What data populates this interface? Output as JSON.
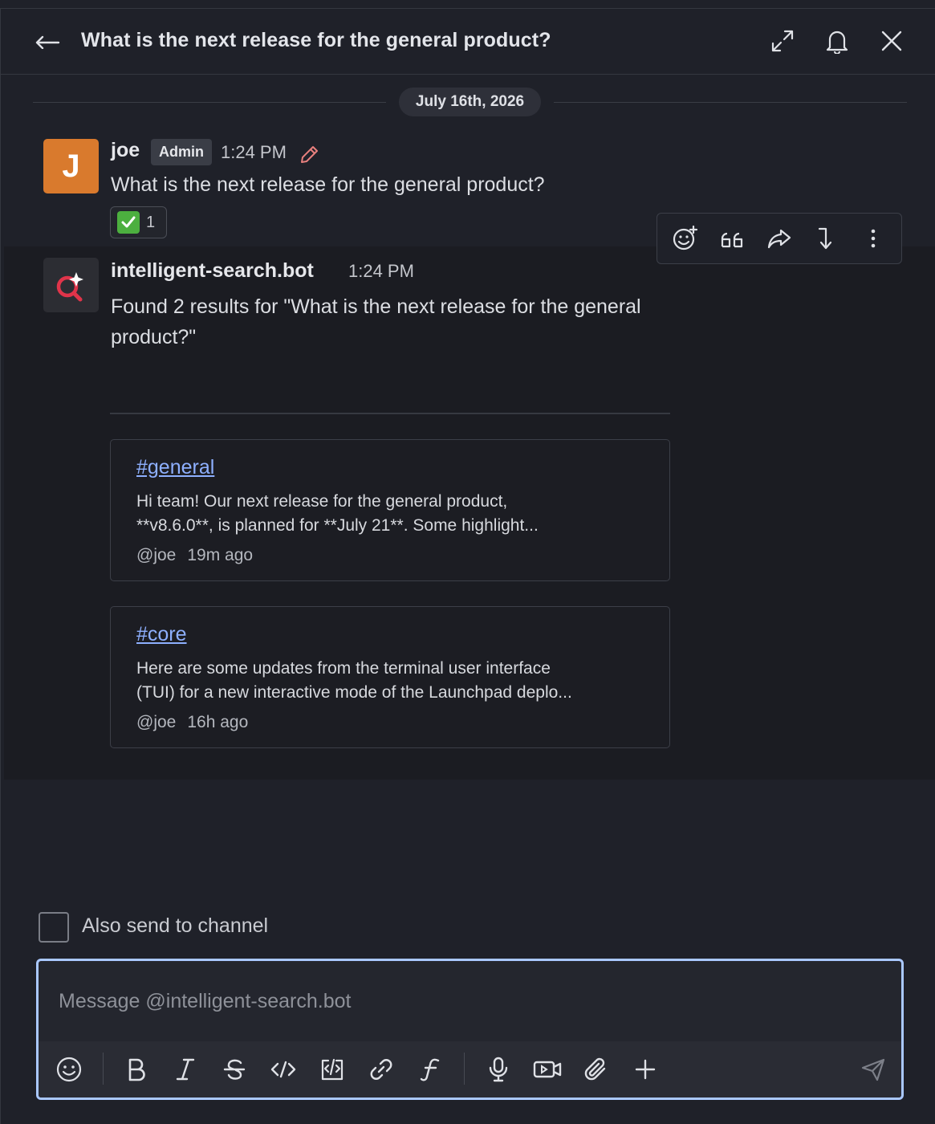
{
  "header": {
    "title": "What is the next release for the general product?",
    "icons": [
      "arrow-left-icon",
      "expand-icon",
      "bell-icon",
      "close-icon"
    ]
  },
  "date_divider": "July 16th, 2026",
  "messages": [
    {
      "author": "joe",
      "avatar_letter": "J",
      "badge": "Admin",
      "time": "1:24 PM",
      "text": "What is the next release for the general product?",
      "reaction": {
        "emoji": "white-check-mark",
        "count": "1"
      }
    },
    {
      "author": "intelligent-search.bot",
      "time": "1:24 PM",
      "text": "Found 2 results for \"What is the next release for the general product?\"",
      "results": [
        {
          "channel": "#general",
          "snippet_line1": "Hi team! Our next release for the general product,",
          "snippet_line2": "**v8.6.0**, is planned for **July 21**. Some highlight...",
          "user": "@joe",
          "age": "19m ago"
        },
        {
          "channel": "#core",
          "snippet_line1": "Here are some updates from the terminal user interface",
          "snippet_line2": "(TUI) for a new interactive mode of the Launchpad deplo...",
          "user": "@joe",
          "age": "16h ago"
        }
      ]
    }
  ],
  "also_send": {
    "label": "Also send to channel",
    "checked": false
  },
  "composer": {
    "placeholder": "Message @intelligent-search.bot",
    "value": ""
  },
  "colors": {
    "accent": "#aac8ff",
    "link": "#8eb0ff",
    "avatar_joe": "#d97a2d",
    "bot_red": "#e0344a"
  }
}
